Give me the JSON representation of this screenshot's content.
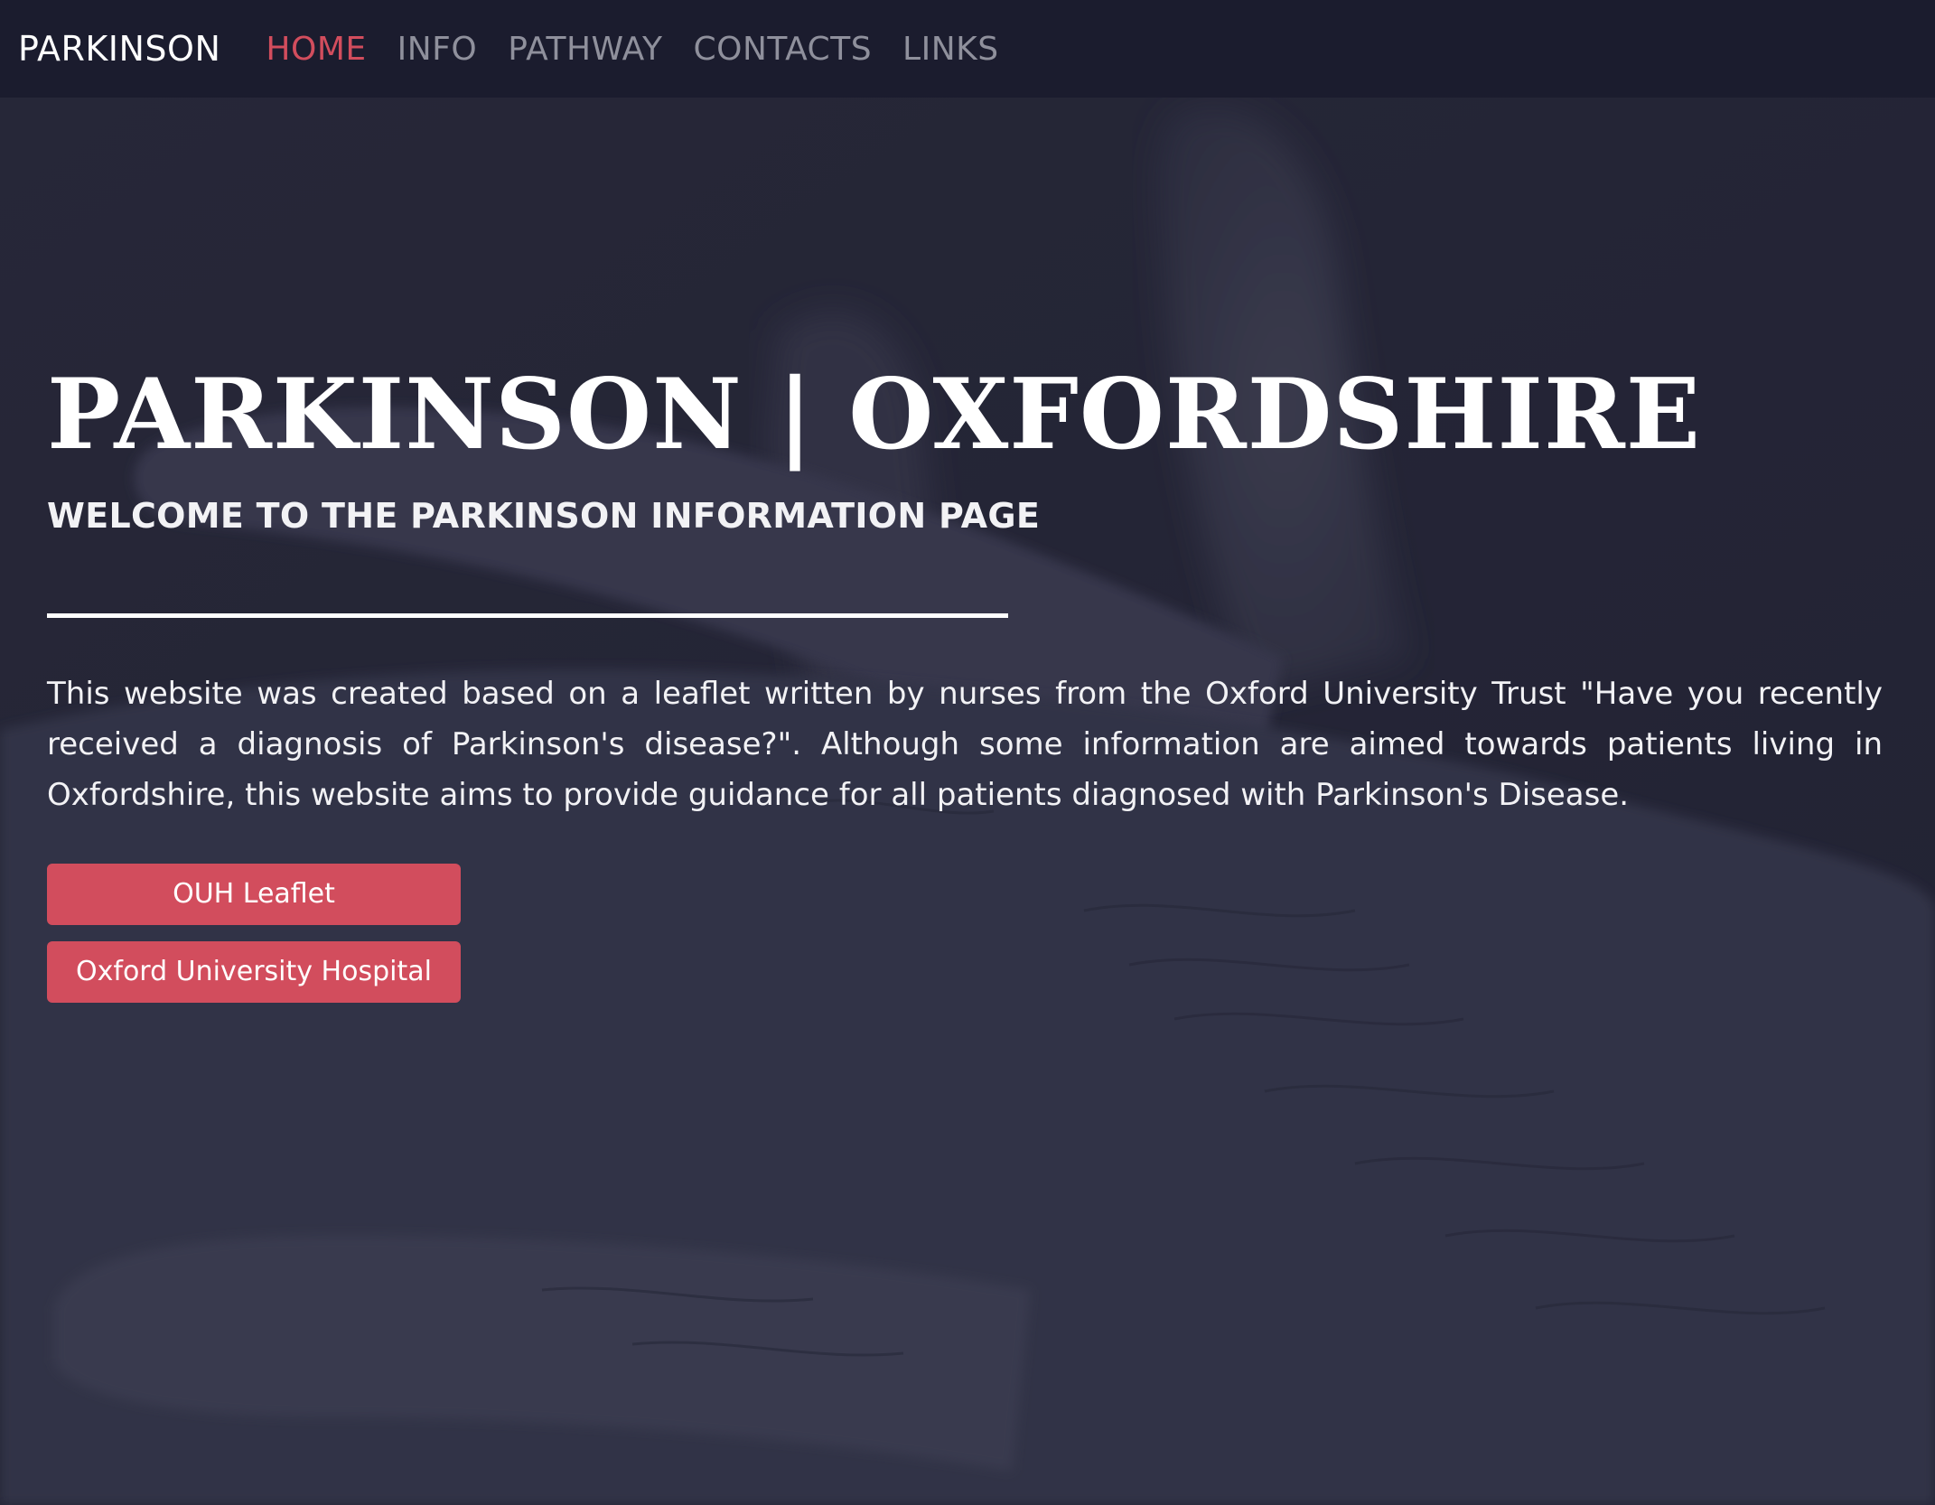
{
  "navbar": {
    "brand": "PARKINSON",
    "items": [
      {
        "label": "HOME",
        "active": true
      },
      {
        "label": "INFO",
        "active": false
      },
      {
        "label": "PATHWAY",
        "active": false
      },
      {
        "label": "CONTACTS",
        "active": false
      },
      {
        "label": "LINKS",
        "active": false
      }
    ]
  },
  "hero": {
    "title": "PARKINSON | OXFORDSHIRE",
    "subtitle": "WELCOME TO THE PARKINSON INFORMATION PAGE",
    "description": "This website was created based on a leaflet written by nurses from the Oxford University Trust \"Have you recently received a diagnosis of Parkinson's disease?\". Although some information are aimed towards patients living in Oxfordshire, this website aims to provide guidance for all patients diagnosed with Parkinson's Disease.",
    "buttons": [
      {
        "label": "OUH Leaflet"
      },
      {
        "label": "Oxford University Hospital"
      }
    ]
  },
  "colors": {
    "navbar_bg": "#1b1c2e",
    "accent": "#d24d5d",
    "nav_inactive": "#8f909c",
    "hero_bg": "#2e2f3e"
  }
}
